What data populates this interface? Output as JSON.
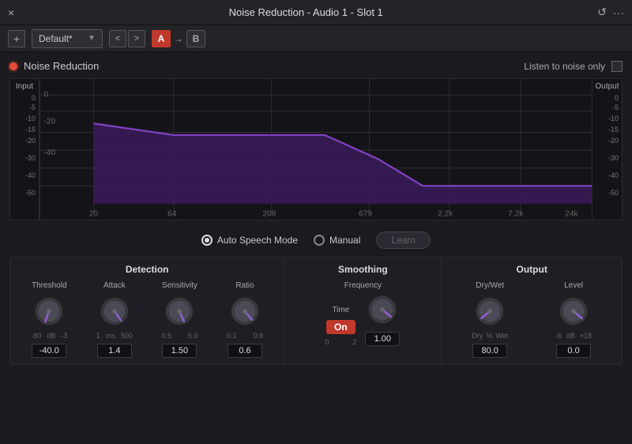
{
  "titleBar": {
    "title": "Noise Reduction - Audio 1 -  Slot 1",
    "closeIcon": "×",
    "historyIcon": "↺",
    "menuIcon": "···"
  },
  "presetBar": {
    "addLabel": "+",
    "presetName": "Default*",
    "prevLabel": "<",
    "nextLabel": ">",
    "aLabel": "A",
    "arrowLabel": "→",
    "bLabel": "B"
  },
  "pluginHeader": {
    "title": "Noise Reduction",
    "listenLabel": "Listen to noise only"
  },
  "spectrum": {
    "inputLabel": "Input",
    "outputLabel": "Output",
    "xLabels": [
      "20",
      "64",
      "208",
      "679",
      "2.2k",
      "7.2k",
      "24k"
    ],
    "yLabels": [
      "0",
      "-5",
      "-10",
      "-15",
      "-20",
      "-30",
      "-40",
      "-50"
    ],
    "inputTicks": [
      "0",
      "-5",
      "-10",
      "-15",
      "-20",
      "-30",
      "-40",
      "-50"
    ],
    "outputTicks": [
      "0",
      "-5",
      "-10",
      "-15",
      "-20",
      "-30",
      "-40",
      "-50"
    ]
  },
  "modeBar": {
    "autoSpeechLabel": "Auto Speech Mode",
    "manualLabel": "Manual",
    "learnLabel": "Learn"
  },
  "detection": {
    "title": "Detection",
    "knobs": [
      {
        "label": "Threshold",
        "min": "-80",
        "max": "-3",
        "unit": "dB",
        "value": "-40.0"
      },
      {
        "label": "Attack",
        "min": "1",
        "max": "500",
        "unit": "ms",
        "value": "1.4"
      },
      {
        "label": "Sensitivity",
        "min": "0.5",
        "max": "5.0",
        "unit": "",
        "value": "1.50"
      },
      {
        "label": "Ratio",
        "min": "0.1",
        "max": "0.9",
        "unit": "",
        "value": "0.6"
      }
    ]
  },
  "smoothing": {
    "title": "Smoothing",
    "subLabel": "Frequency",
    "timeLabel": "Time",
    "onLabel": "On",
    "timeMin": "0",
    "timeMax": "2",
    "freqValue": "1.00"
  },
  "output": {
    "title": "Output",
    "knobs": [
      {
        "label": "Dry/Wet",
        "min": "Dry",
        "max": "Wet",
        "unit": "%",
        "value": "80.0"
      },
      {
        "label": "Level",
        "min": "-6",
        "max": "+18",
        "unit": "dB",
        "value": "0.0"
      }
    ]
  },
  "knobAngles": {
    "threshold": 200,
    "attack": 145,
    "sensitivity": 155,
    "ratio": 140,
    "dryWet": 230,
    "level": 130,
    "frequency": 130
  }
}
